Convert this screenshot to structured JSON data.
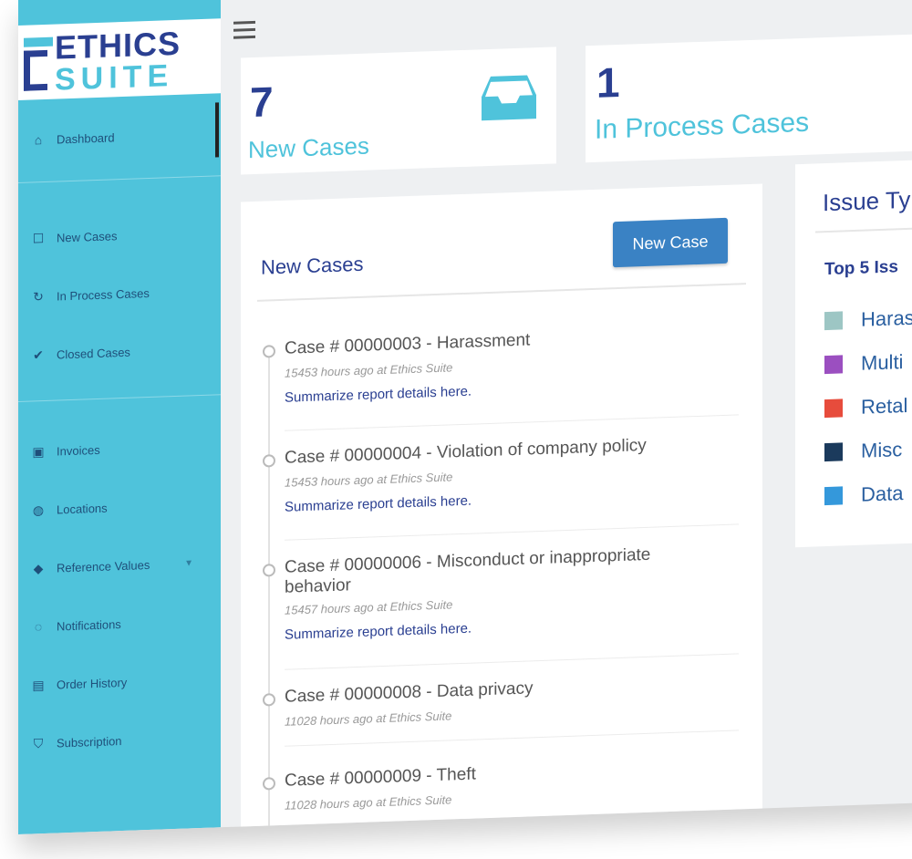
{
  "brand": {
    "line1": "ETHICS",
    "line2": "SUITE"
  },
  "sidebar": {
    "items": [
      {
        "label": "Dashboard",
        "icon": "dashboard-icon",
        "glyph": "⌂"
      },
      {
        "label": "New Cases",
        "icon": "inbox-icon",
        "glyph": "☐"
      },
      {
        "label": "In Process Cases",
        "icon": "refresh-icon",
        "glyph": "↻"
      },
      {
        "label": "Closed Cases",
        "icon": "check-icon",
        "glyph": "✔"
      },
      {
        "label": "Invoices",
        "icon": "money-icon",
        "glyph": "▣"
      },
      {
        "label": "Locations",
        "icon": "globe-icon",
        "glyph": "◍"
      },
      {
        "label": "Reference Values",
        "icon": "tag-icon",
        "glyph": "◆"
      },
      {
        "label": "Notifications",
        "icon": "chat-icon",
        "glyph": "◌"
      },
      {
        "label": "Order History",
        "icon": "list-icon",
        "glyph": "▤"
      },
      {
        "label": "Subscription",
        "icon": "shield-icon",
        "glyph": "⛉"
      }
    ]
  },
  "stats": {
    "new_cases": {
      "count": "7",
      "label": "New Cases"
    },
    "in_process": {
      "count": "1",
      "label": "In Process Cases"
    }
  },
  "cases_panel": {
    "title": "New Cases",
    "button": "New Case",
    "cases": [
      {
        "title": "Case # 00000003 - Harassment",
        "meta_time": "15453 hours ago at",
        "meta_org": "Ethics Suite",
        "link": "Summarize report details here."
      },
      {
        "title": "Case # 00000004 - Violation of company policy",
        "meta_time": "15453 hours ago at",
        "meta_org": "Ethics Suite",
        "link": "Summarize report details here."
      },
      {
        "title": "Case # 00000006 - Misconduct or inappropriate behavior",
        "meta_time": "15457 hours ago at",
        "meta_org": "Ethics Suite",
        "link": "Summarize report details here."
      },
      {
        "title": "Case # 00000008 - Data privacy",
        "meta_time": "11028 hours ago at",
        "meta_org": "Ethics Suite",
        "link": ""
      },
      {
        "title": "Case # 00000009 - Theft",
        "meta_time": "11028 hours ago at",
        "meta_org": "Ethics Suite",
        "link": ""
      }
    ]
  },
  "issue_panel": {
    "title": "Issue Ty",
    "subtitle": "Top 5 Iss",
    "legend": [
      {
        "label": "Haras",
        "color": "#9dc6c4"
      },
      {
        "label": "Multi",
        "color": "#9b4fc0"
      },
      {
        "label": "Retal",
        "color": "#e74c3c"
      },
      {
        "label": "Misc",
        "color": "#1b3a5c"
      },
      {
        "label": "Data",
        "color": "#3498db"
      }
    ]
  }
}
